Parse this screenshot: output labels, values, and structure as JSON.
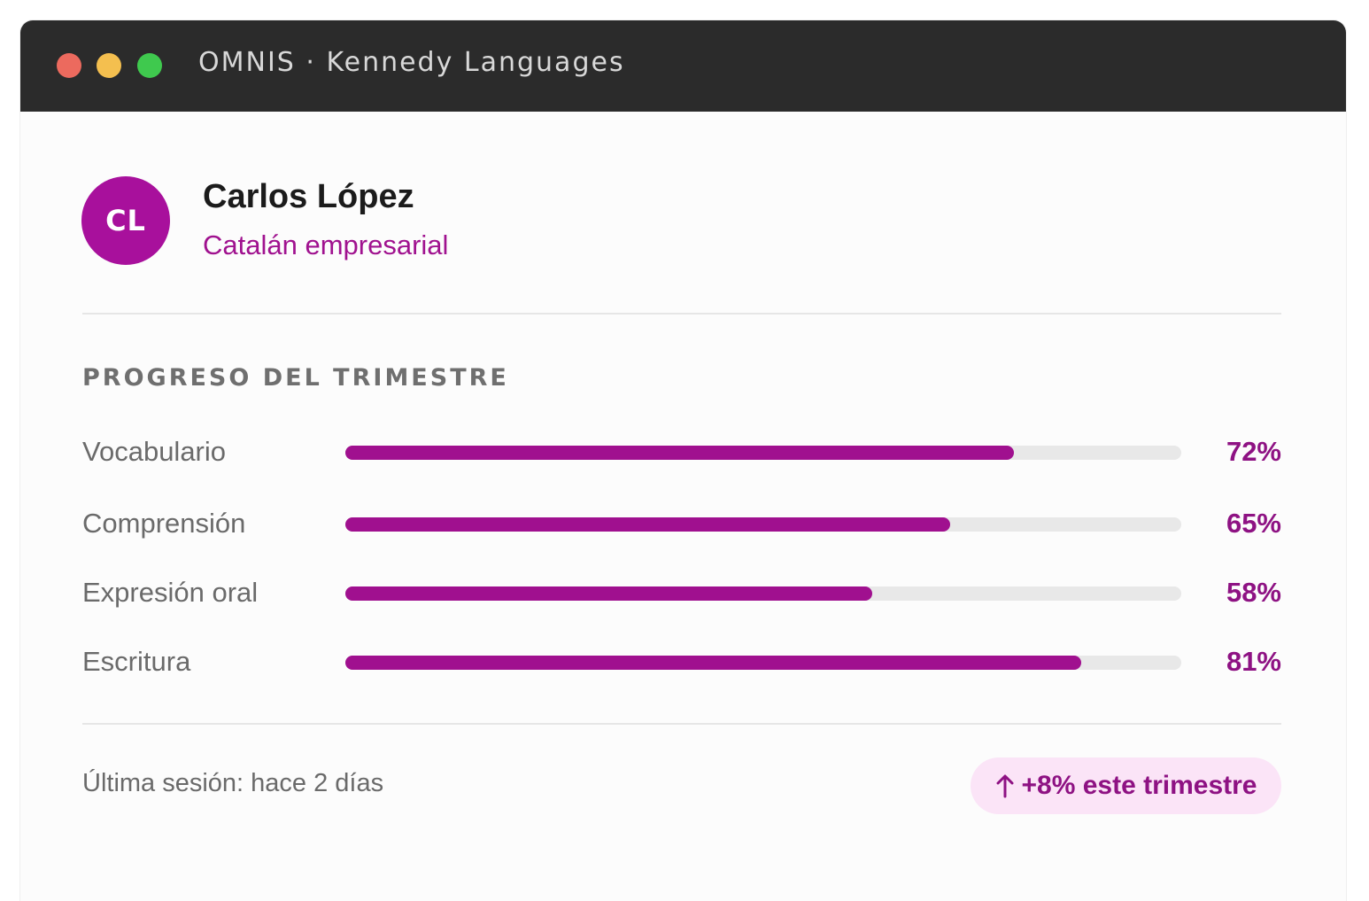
{
  "window": {
    "title": "OMNIS · Kennedy Languages"
  },
  "student": {
    "initials": "CL",
    "name": "Carlos López",
    "course": "Catalán empresarial"
  },
  "progress": {
    "section_title": "PROGRESO DEL TRIMESTRE",
    "skills": [
      {
        "label": "Vocabulario",
        "percent_label": "72%",
        "value": 0.8
      },
      {
        "label": "Comprensión",
        "percent_label": "65%",
        "value": 0.724
      },
      {
        "label": "Expresión oral",
        "percent_label": "58%",
        "value": 0.63
      },
      {
        "label": "Escritura",
        "percent_label": "81%",
        "value": 0.88
      }
    ]
  },
  "footer": {
    "last_session": "Última sesión: hace 2 días",
    "trend": "+8% este trimestre",
    "trend_icon": "arrow-up-icon"
  },
  "colors": {
    "accent": "#a0108f",
    "accent_text": "#8e1283",
    "badge_bg": "#fbe4f7",
    "track": "#e8e8e8",
    "titlebar": "#2b2b2b"
  }
}
